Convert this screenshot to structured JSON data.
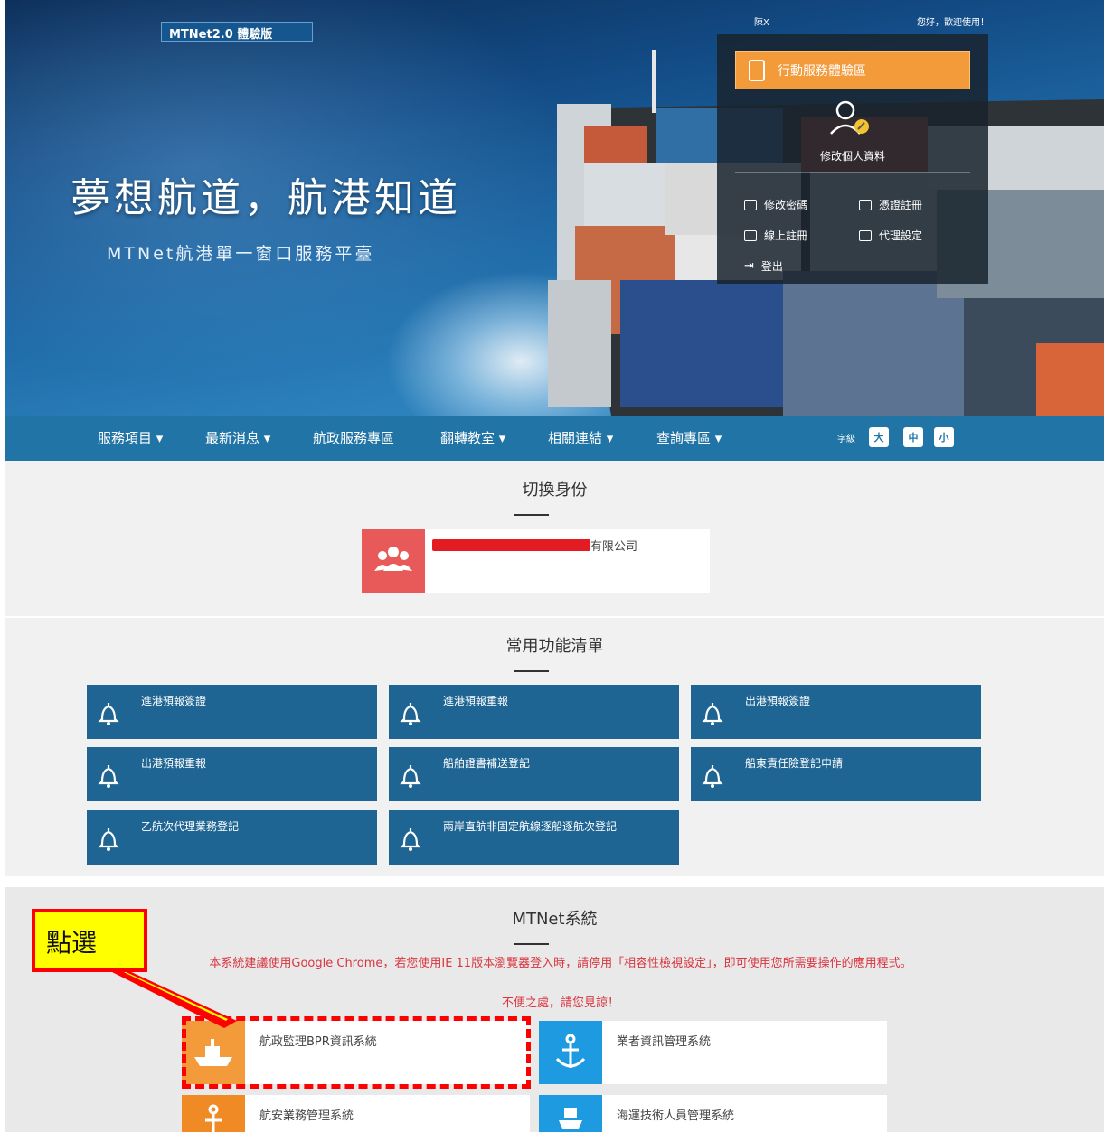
{
  "hero": {
    "version_badge": "MTNet2.0 體驗版",
    "title": "夢想航道，航港知道",
    "subtitle": "MTNet航港單一窗口服務平臺",
    "top_right_a": "陳X",
    "top_right_b": "您好，歡迎使用！"
  },
  "user_panel": {
    "mobile_button": "行動服務體驗區",
    "profile_label": "修改個人資料",
    "items": [
      "修改密碼",
      "憑證註冊",
      "線上註冊",
      "代理設定",
      "登出"
    ]
  },
  "nav": {
    "items": [
      "服務項目 ▾",
      "最新消息 ▾",
      "航政服務專區",
      "翻轉教室 ▾",
      "相關連結 ▾",
      "查詢專區 ▾"
    ],
    "font_size_label": "字級",
    "font_sizes": [
      "大",
      "中",
      "小"
    ]
  },
  "identity": {
    "title": "切換身份",
    "company_suffix": "有限公司"
  },
  "functions": {
    "title": "常用功能清單",
    "items": [
      "進港預報簽證",
      "進港預報重報",
      "出港預報簽證",
      "出港預報重報",
      "船舶證書補送登記",
      "船東責任險登記申請",
      "乙航次代理業務登記",
      "兩岸直航非固定航線逐船逐航次登記"
    ]
  },
  "systems": {
    "title": "MTNet系統",
    "notice_line1": "本系統建議使用Google Chrome，若您使用IE 11版本瀏覽器登入時，請停用「相容性檢視設定」，即可使用您所需要操作的應用程式。",
    "notice_line2": "不便之處，請您見諒！",
    "items": [
      "航政監理BPR資訊系統",
      "業者資訊管理系統",
      "航安業務管理系統",
      "海運技術人員管理系統"
    ]
  },
  "annotation": {
    "callout": "點選"
  },
  "colors": {
    "nav": "#2174a6",
    "function_button": "#1f6593",
    "orange": "#f39a3b",
    "blue_icon": "#1e9be0",
    "identity_icon": "#e85a5a",
    "annotation_red": "#ff0000",
    "annotation_yellow": "#ffff00"
  }
}
